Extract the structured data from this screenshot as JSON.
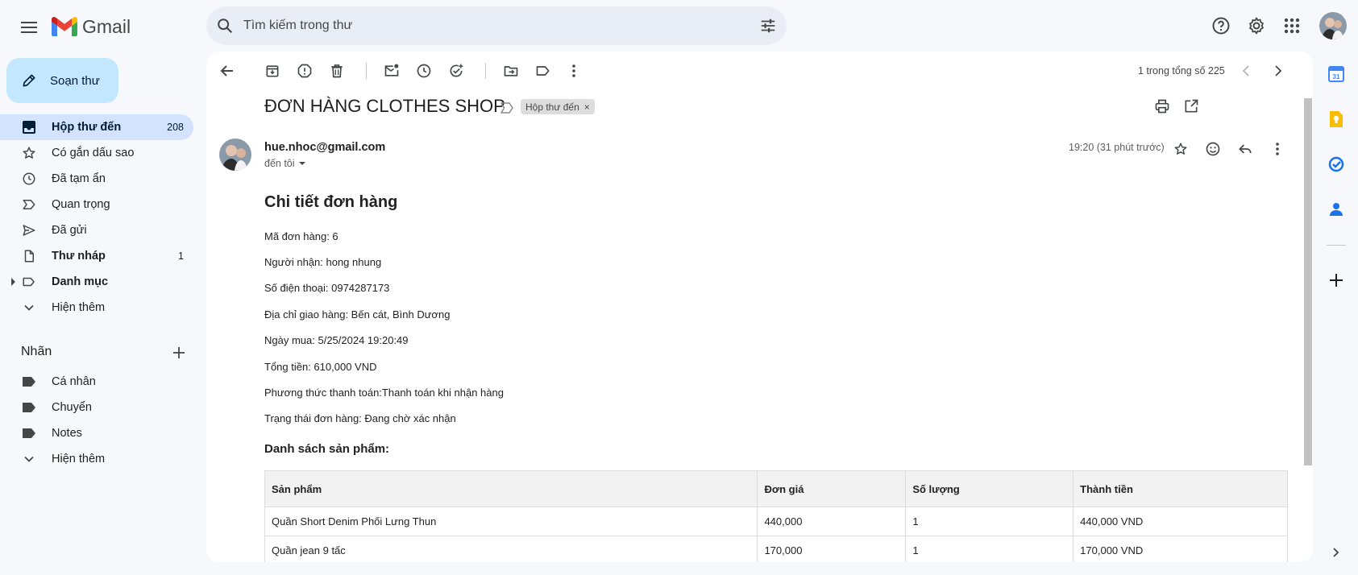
{
  "app": {
    "name": "Gmail"
  },
  "search": {
    "placeholder": "Tìm kiếm trong thư"
  },
  "compose": {
    "label": "Soạn thư"
  },
  "sidebar": {
    "items": [
      {
        "label": "Hộp thư đến",
        "count": "208",
        "icon": "inbox-icon"
      },
      {
        "label": "Có gắn dấu sao",
        "count": "",
        "icon": "star-icon"
      },
      {
        "label": "Đã tạm ẩn",
        "count": "",
        "icon": "clock-icon"
      },
      {
        "label": "Quan trọng",
        "count": "",
        "icon": "important-icon"
      },
      {
        "label": "Đã gửi",
        "count": "",
        "icon": "send-icon"
      },
      {
        "label": "Thư nháp",
        "count": "1",
        "icon": "draft-icon"
      },
      {
        "label": "Danh mục",
        "count": "",
        "icon": "label-outline-icon"
      },
      {
        "label": "Hiện thêm",
        "count": "",
        "icon": "chevron-down-icon"
      }
    ],
    "labels_heading": "Nhãn",
    "labels": [
      {
        "label": "Cá nhân"
      },
      {
        "label": "Chuyển"
      },
      {
        "label": "Notes"
      },
      {
        "label": "Hiện thêm"
      }
    ]
  },
  "toolbar": {
    "pager": "1 trong tổng số 225"
  },
  "email": {
    "subject": "ĐƠN HÀNG CLOTHES SHOP",
    "inbox_chip": "Hộp thư đến",
    "inbox_chip_close": "×",
    "sender": "hue.nhoc@gmail.com",
    "to": "đến tôi",
    "time": "19:20 (31 phút trước)",
    "body_title": "Chi tiết đơn hàng",
    "fields": [
      "Mã đơn hàng: 6",
      "Người nhận: hong nhung",
      "Số điện thoại: 0974287173",
      "Địa chỉ giao hàng: Bến cát, Bình Dương",
      "Ngày mua: 5/25/2024 19:20:49",
      "Tổng tiền: 610,000 VND",
      "Phương thức thanh toán:Thanh toán khi nhận hàng",
      "Trạng thái đơn hàng: Đang chờ xác nhận"
    ],
    "list_title": "Danh sách sản phẩm:",
    "table": {
      "headers": [
        "Sản phẩm",
        "Đơn giá",
        "Số lượng",
        "Thành tiền"
      ],
      "rows": [
        [
          "Quần Short Denim Phối Lưng Thun",
          "440,000",
          "1",
          "440,000 VND"
        ],
        [
          "Quần jean 9 tấc",
          "170,000",
          "1",
          "170,000 VND"
        ]
      ]
    }
  },
  "colors": {
    "background": "#f6f8fc",
    "compose": "#c2e7ff",
    "active_nav": "#d3e3fd",
    "gmail_red": "#ea4335",
    "gmail_blue": "#4285f4",
    "gmail_green": "#34a853",
    "gmail_yellow": "#fbbc04"
  }
}
